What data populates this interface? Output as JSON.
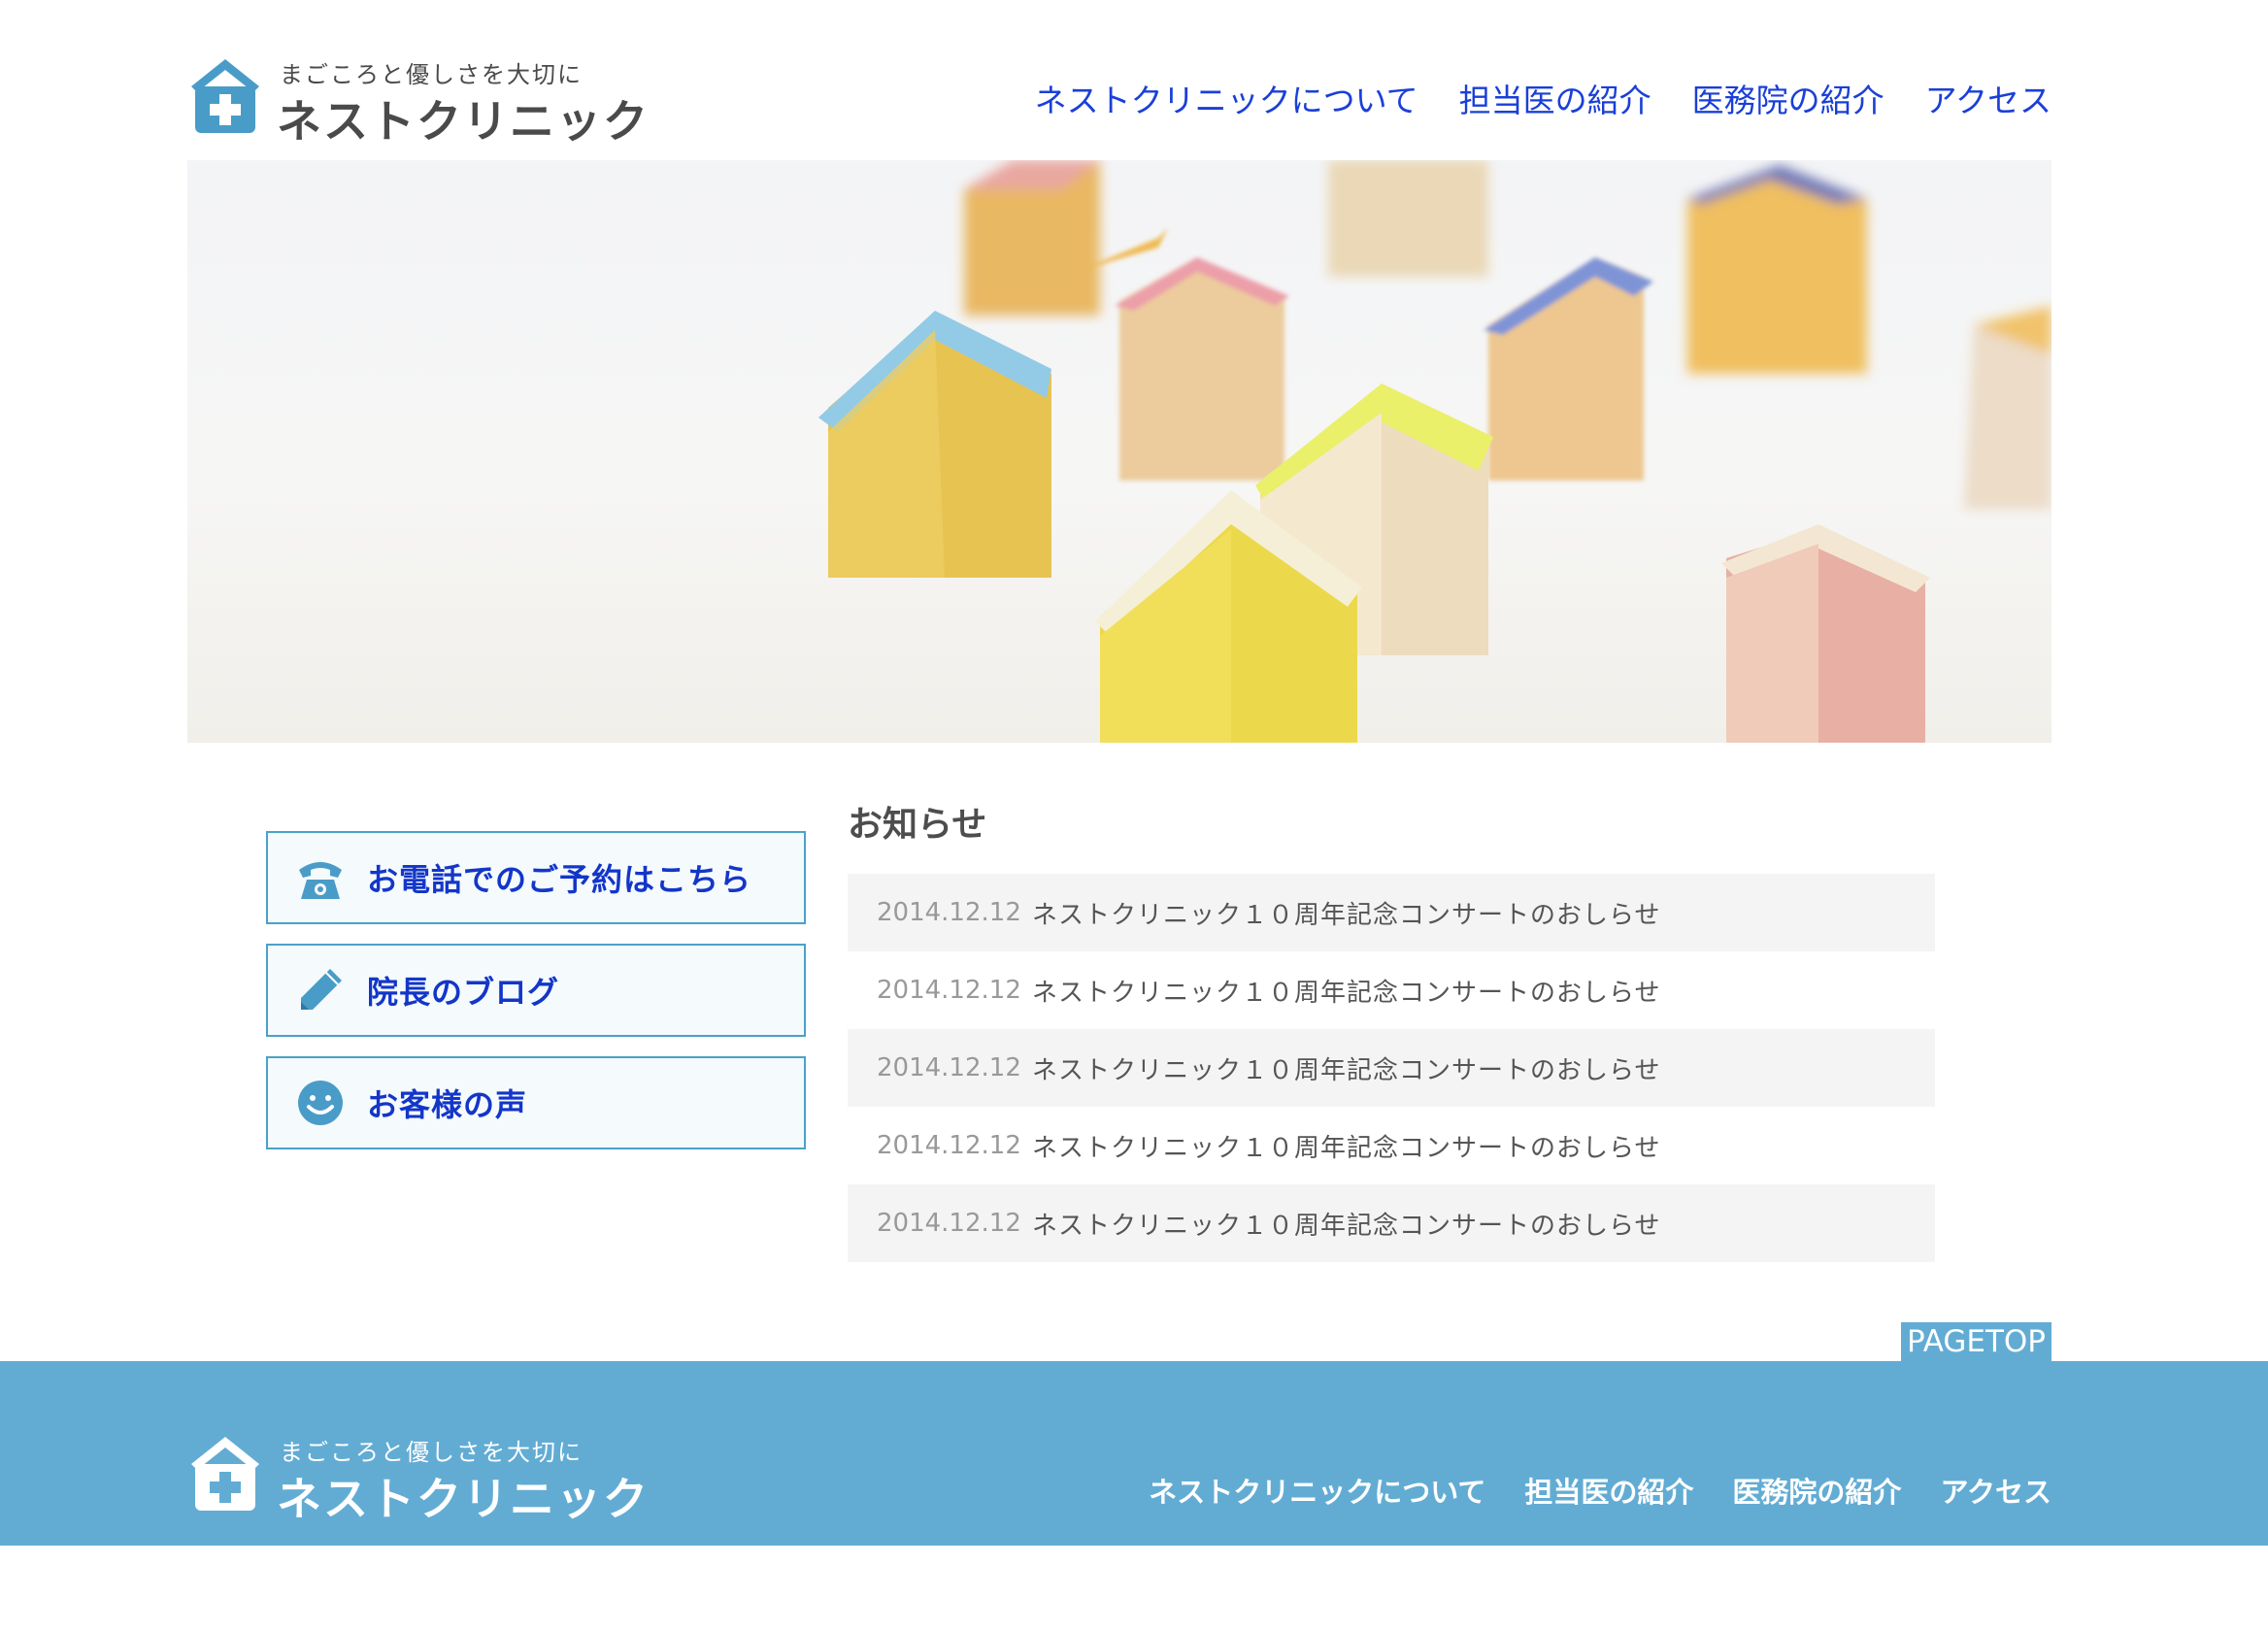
{
  "colors": {
    "brand": "#62acd4",
    "nav_link": "#1a3fd8",
    "button_text": "#1336c9",
    "button_border": "#4aa2c9"
  },
  "logo": {
    "tagline": "まごころと優しさを大切に",
    "name": "ネストクリニック",
    "icon": "house-cross-icon"
  },
  "nav": [
    {
      "label": "ネストクリニックについて"
    },
    {
      "label": "担当医の紹介"
    },
    {
      "label": "医務院の紹介"
    },
    {
      "label": "アクセス"
    }
  ],
  "sidebar": [
    {
      "label": "お電話でのご予約はこちら",
      "icon": "telephone-icon"
    },
    {
      "label": "院長のブログ",
      "icon": "pencil-icon"
    },
    {
      "label": "お客様の声",
      "icon": "smiley-icon"
    }
  ],
  "news": {
    "title": "お知らせ",
    "items": [
      {
        "date": "2014.12.12",
        "text": "ネストクリニック１０周年記念コンサートのおしらせ"
      },
      {
        "date": "2014.12.12",
        "text": "ネストクリニック１０周年記念コンサートのおしらせ"
      },
      {
        "date": "2014.12.12",
        "text": "ネストクリニック１０周年記念コンサートのおしらせ"
      },
      {
        "date": "2014.12.12",
        "text": "ネストクリニック１０周年記念コンサートのおしらせ"
      },
      {
        "date": "2014.12.12",
        "text": "ネストクリニック１０周年記念コンサートのおしらせ"
      }
    ]
  },
  "pagetop": "PAGETOP",
  "footer": {
    "logo": {
      "tagline": "まごころと優しさを大切に",
      "name": "ネストクリニック"
    },
    "nav": [
      {
        "label": "ネストクリニックについて"
      },
      {
        "label": "担当医の紹介"
      },
      {
        "label": "医務院の紹介"
      },
      {
        "label": "アクセス"
      }
    ]
  }
}
